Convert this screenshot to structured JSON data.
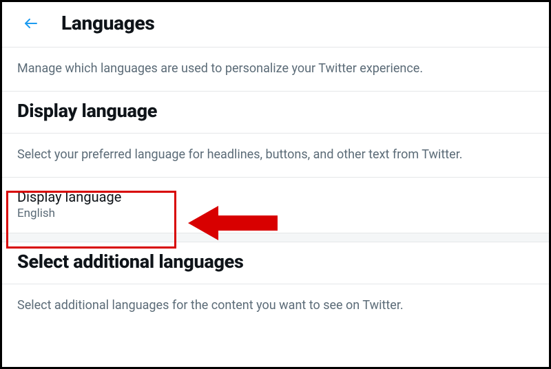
{
  "header": {
    "title": "Languages"
  },
  "intro": {
    "description": "Manage which languages are used to personalize your Twitter experience."
  },
  "display_language": {
    "heading": "Display language",
    "description": "Select your preferred language for headlines, buttons, and other text from Twitter.",
    "row_label": "Display language",
    "row_value": "English"
  },
  "additional_languages": {
    "heading": "Select additional languages",
    "description": "Select additional languages for the content you want to see on Twitter."
  },
  "annotation": {
    "highlight_color": "#d80000"
  }
}
